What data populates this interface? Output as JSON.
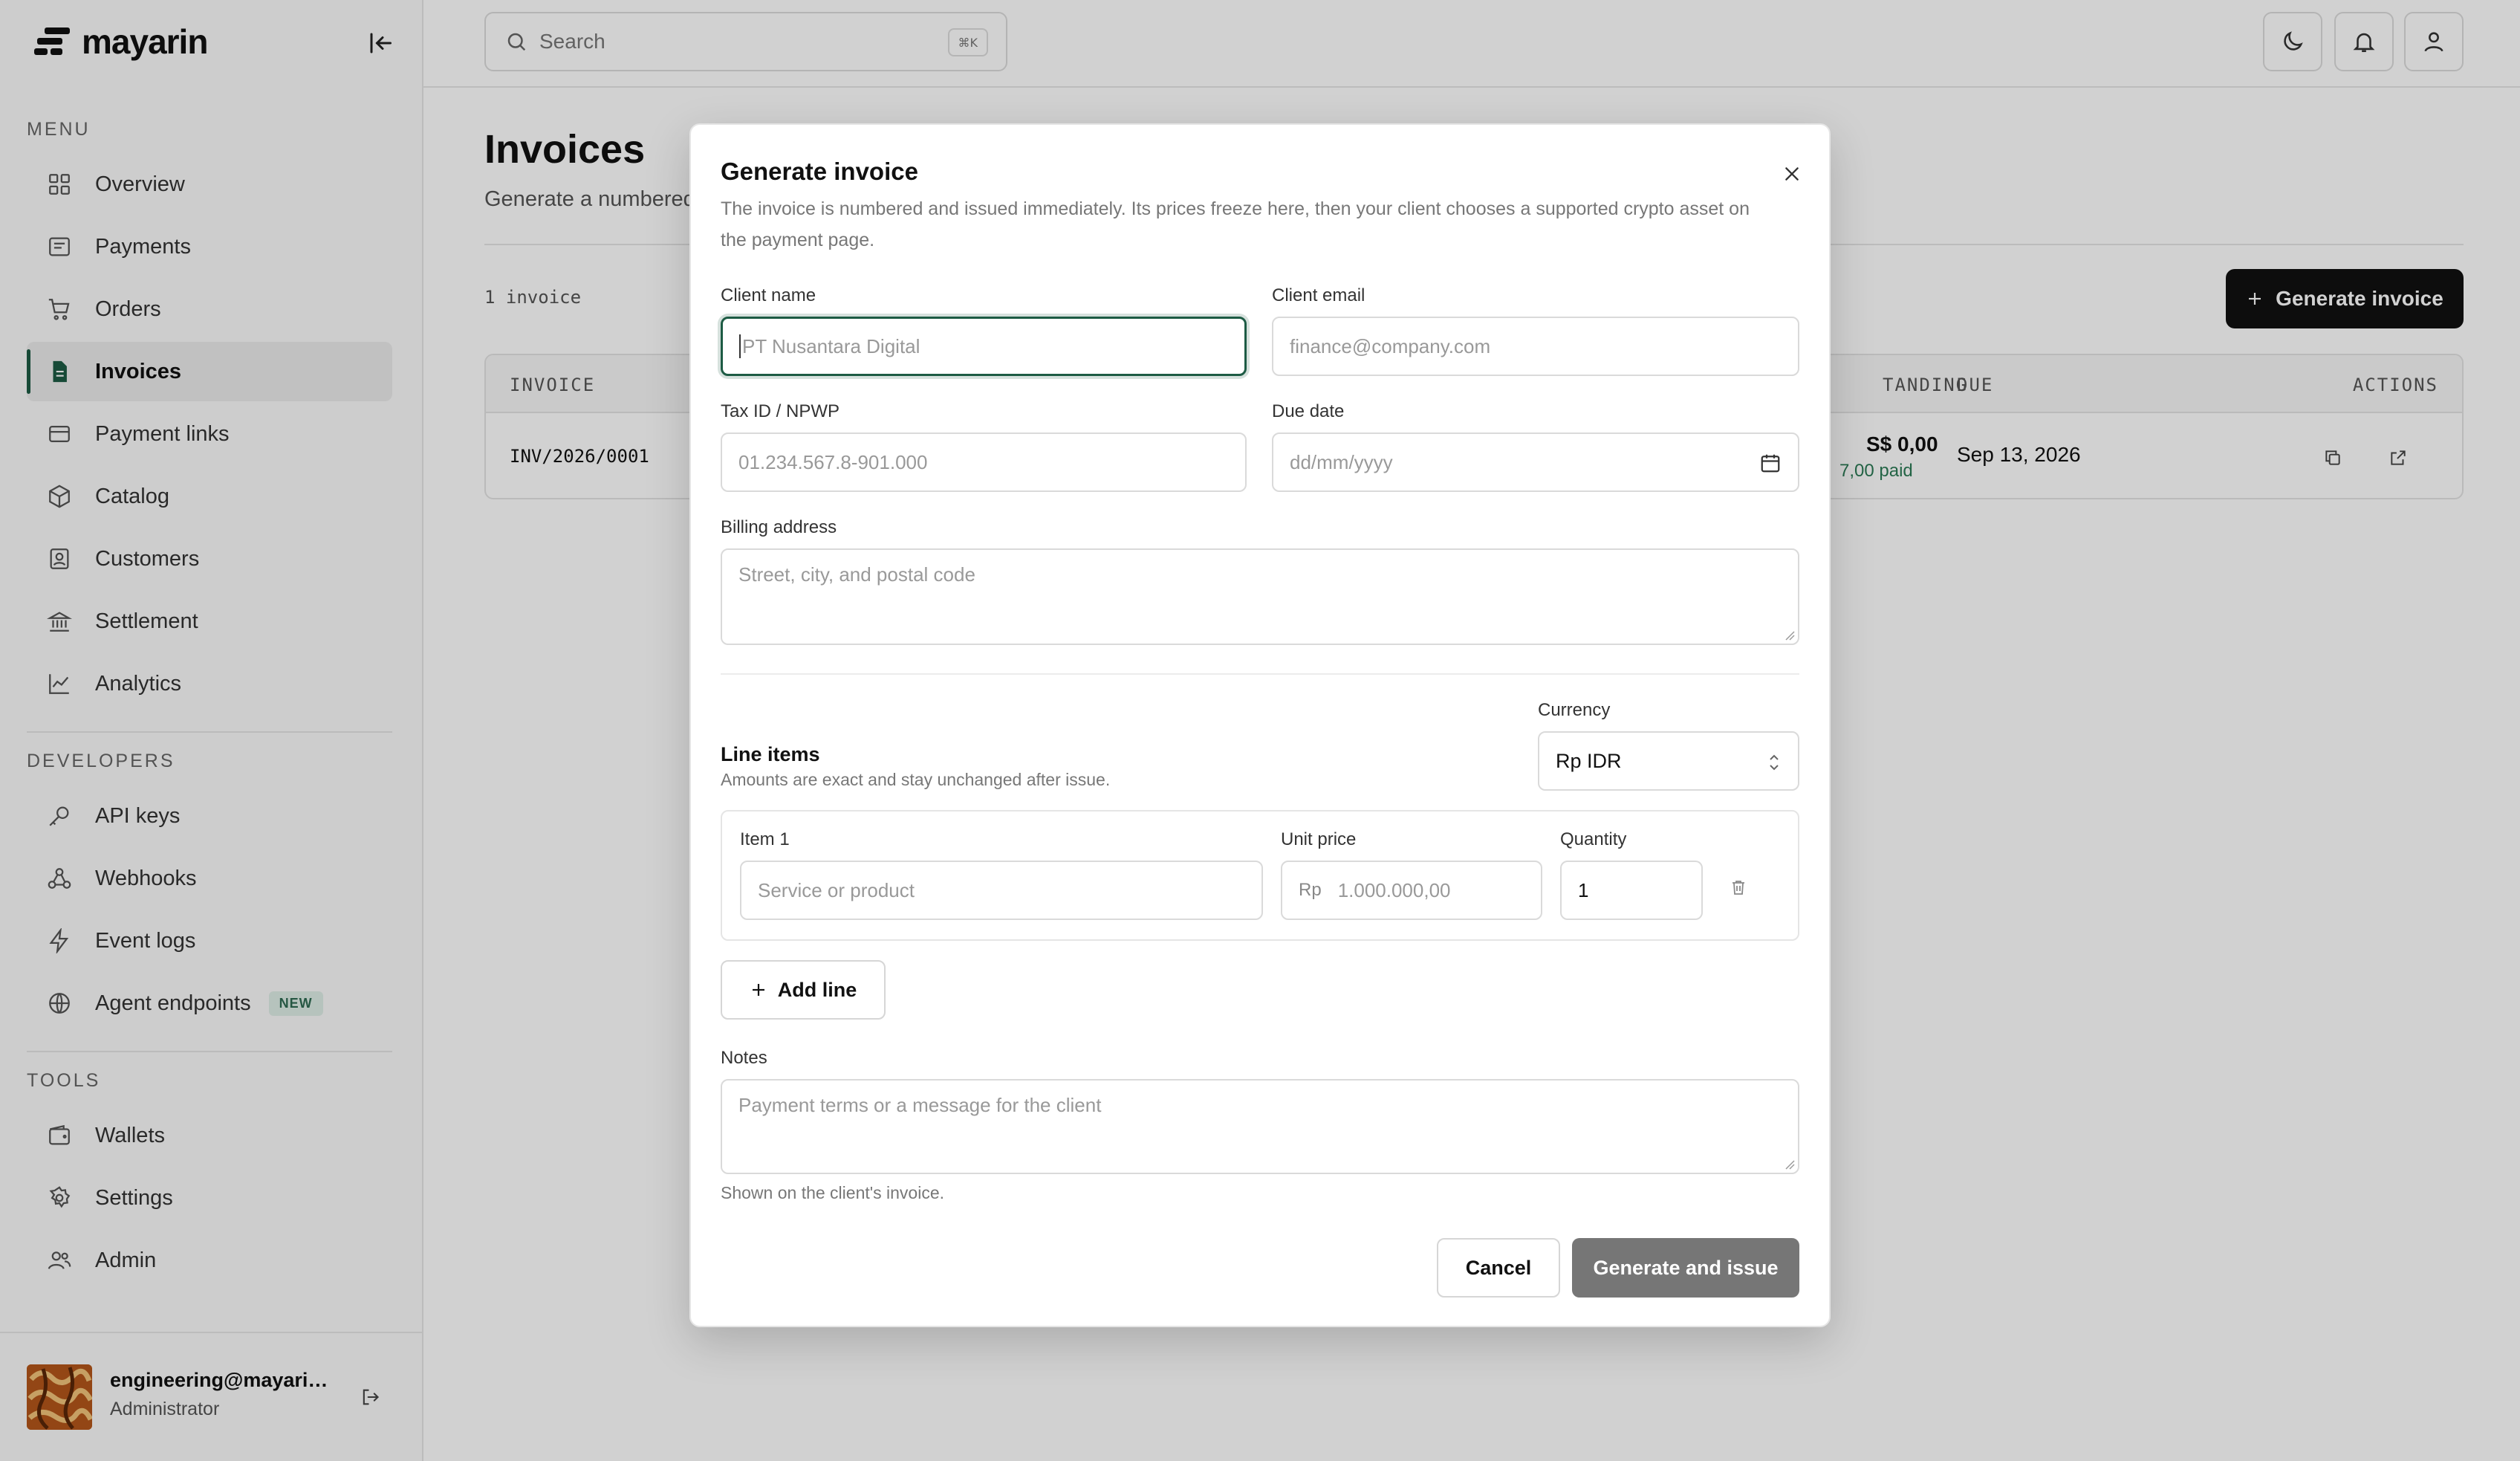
{
  "brand": {
    "name": "mayarin"
  },
  "sidebar": {
    "menu_label": "MENU",
    "menu_items": [
      {
        "label": "Overview",
        "icon": "grid-icon"
      },
      {
        "label": "Payments",
        "icon": "receipt-icon"
      },
      {
        "label": "Orders",
        "icon": "cart-icon"
      },
      {
        "label": "Invoices",
        "icon": "document-icon",
        "active": true
      },
      {
        "label": "Payment links",
        "icon": "card-icon"
      },
      {
        "label": "Catalog",
        "icon": "box-icon"
      },
      {
        "label": "Customers",
        "icon": "contact-icon"
      },
      {
        "label": "Settlement",
        "icon": "bank-icon"
      },
      {
        "label": "Analytics",
        "icon": "chart-icon"
      }
    ],
    "developers_label": "DEVELOPERS",
    "developer_items": [
      {
        "label": "API keys",
        "icon": "key-icon"
      },
      {
        "label": "Webhooks",
        "icon": "webhook-icon"
      },
      {
        "label": "Event logs",
        "icon": "bolt-icon"
      },
      {
        "label": "Agent endpoints",
        "icon": "globe-icon",
        "badge": "NEW"
      }
    ],
    "tools_label": "TOOLS",
    "tool_items": [
      {
        "label": "Wallets",
        "icon": "wallet-icon"
      },
      {
        "label": "Settings",
        "icon": "gear-icon"
      },
      {
        "label": "Admin",
        "icon": "users-icon"
      }
    ],
    "user": {
      "email": "engineering@mayarin.x...",
      "role": "Administrator"
    }
  },
  "topbar": {
    "search_placeholder": "Search",
    "search_shortcut": "⌘K"
  },
  "main": {
    "title": "Invoices",
    "subtitle": "Generate a numbered",
    "count": "1 invoice",
    "generate_button": "Generate invoice",
    "table": {
      "columns": {
        "invoice": "INVOICE",
        "outstanding": "TANDING",
        "due": "DUE",
        "actions": "ACTIONS"
      },
      "rows": [
        {
          "invoice": "INV/2026/0001",
          "outstanding": "S$ 0,00",
          "paid": "7,00 paid",
          "due": "Sep 13, 2026"
        }
      ]
    }
  },
  "modal": {
    "title": "Generate invoice",
    "description": "The invoice is numbered and issued immediately. Its prices freeze here, then your client chooses a supported crypto asset on the payment page.",
    "client_name_label": "Client name",
    "client_name_placeholder": "PT Nusantara Digital",
    "client_email_label": "Client email",
    "client_email_placeholder": "finance@company.com",
    "tax_id_label": "Tax ID / NPWP",
    "tax_id_placeholder": "01.234.567.8-901.000",
    "due_date_label": "Due date",
    "due_date_placeholder": "dd/mm/yyyy",
    "billing_label": "Billing address",
    "billing_placeholder": "Street, city, and postal code",
    "currency_label": "Currency",
    "currency_value": "Rp IDR",
    "line_items_title": "Line items",
    "line_items_sub": "Amounts are exact and stay unchanged after issue.",
    "item_label": "Item 1",
    "item_placeholder": "Service or product",
    "unit_price_label": "Unit price",
    "unit_price_prefix": "Rp",
    "unit_price_placeholder": "1.000.000,00",
    "quantity_label": "Quantity",
    "quantity_value": "1",
    "add_line": "Add line",
    "notes_label": "Notes",
    "notes_placeholder": "Payment terms or a message for the client",
    "notes_hint": "Shown on the client's invoice.",
    "cancel": "Cancel",
    "submit": "Generate and issue"
  },
  "colors": {
    "accent": "#1d5b44",
    "primary_button": "#111111",
    "disabled_button": "#767676",
    "paid_green": "#2b7a55"
  }
}
